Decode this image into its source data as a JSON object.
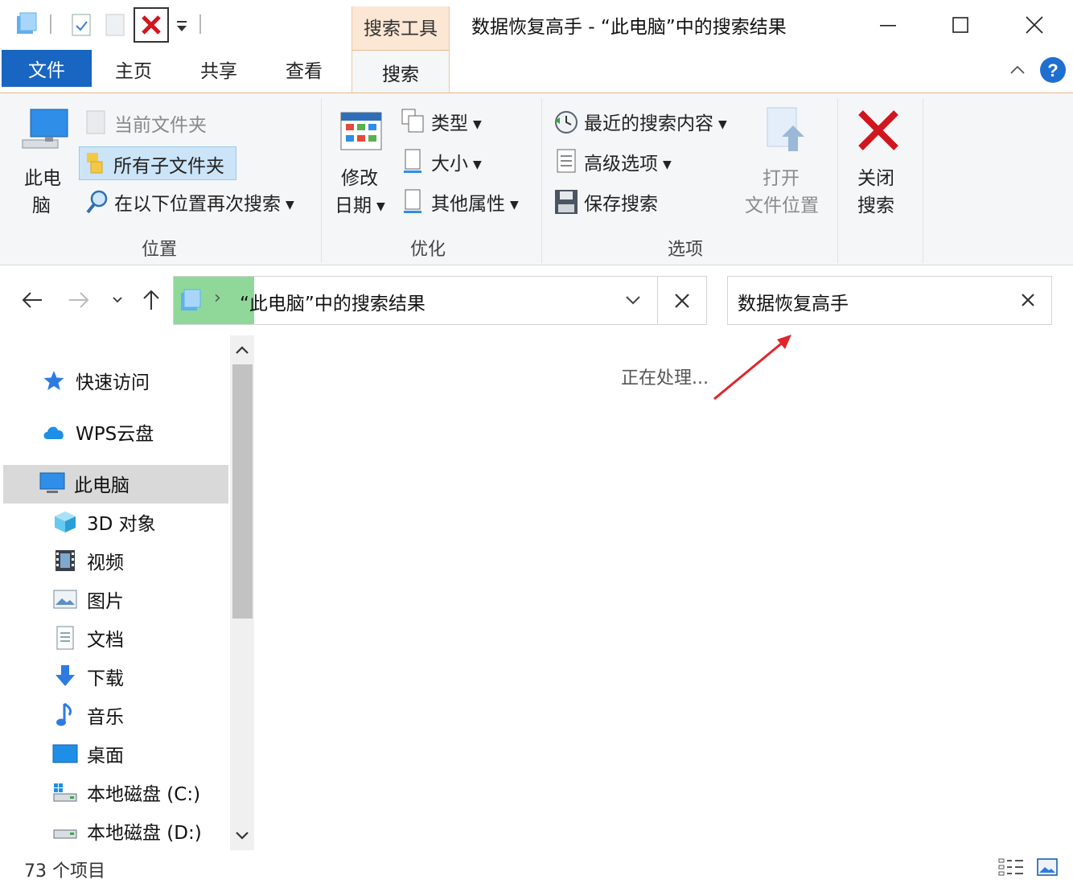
{
  "window": {
    "title": "数据恢复高手 - “此电脑”中的搜索结果",
    "context_tab_group": "搜索工具"
  },
  "tabs": {
    "file": "文件",
    "home": "主页",
    "share": "共享",
    "view": "查看",
    "search": "搜索"
  },
  "ribbon": {
    "location": {
      "this_pc_line1": "此电",
      "this_pc_line2": "脑",
      "current_folder": "当前文件夹",
      "all_subfolders": "所有子文件夹",
      "search_again_in": "在以下位置再次搜索",
      "group_label": "位置"
    },
    "refine": {
      "date_modified_line1": "修改",
      "date_modified_line2": "日期",
      "kind": "类型",
      "size": "大小",
      "other_properties": "其他属性",
      "group_label": "优化"
    },
    "options": {
      "recent_searches": "最近的搜索内容",
      "advanced_options": "高级选项",
      "save_search": "保存搜索",
      "open_location_line1": "打开",
      "open_location_line2": "文件位置",
      "group_label": "选项"
    },
    "close_search_line1": "关闭",
    "close_search_line2": "搜索"
  },
  "address": {
    "breadcrumb_sep": "›",
    "path": "“此电脑”中的搜索结果"
  },
  "search": {
    "query": "数据恢复高手"
  },
  "sidebar": {
    "items": [
      {
        "label": "快速访问"
      },
      {
        "label": "WPS云盘"
      },
      {
        "label": "此电脑"
      },
      {
        "label": "3D 对象"
      },
      {
        "label": "视频"
      },
      {
        "label": "图片"
      },
      {
        "label": "文档"
      },
      {
        "label": "下载"
      },
      {
        "label": "音乐"
      },
      {
        "label": "桌面"
      },
      {
        "label": "本地磁盘 (C:)"
      },
      {
        "label": "本地磁盘 (D:)"
      }
    ]
  },
  "content": {
    "status_message": "正在处理..."
  },
  "statusbar": {
    "item_count": "73 个项目"
  },
  "colors": {
    "accent": "#1865c2",
    "context_tab": "#fbe7d3",
    "address_highlight": "#8fd89a",
    "annotation_arrow": "#e0252b",
    "close_x": "#d0161e"
  }
}
